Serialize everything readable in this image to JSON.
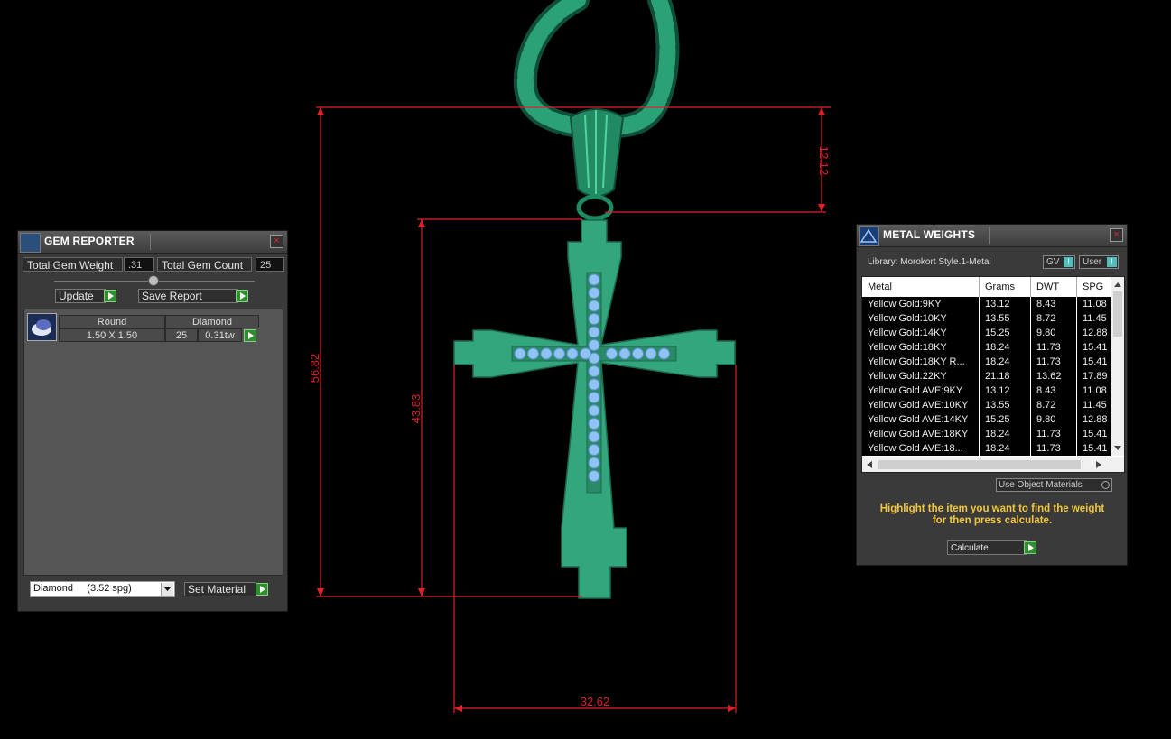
{
  "dimensions": {
    "total_height": "56.82",
    "bail_height": "12.12",
    "cross_height": "43.83",
    "width": "32.62"
  },
  "gem_reporter": {
    "title": "GEM REPORTER",
    "total_weight_label": "Total Gem Weight",
    "total_weight_value": ".31",
    "total_count_label": "Total Gem Count",
    "total_count_value": "25",
    "update_label": "Update",
    "save_report_label": "Save Report",
    "gem": {
      "shape": "Round",
      "material": "Diamond",
      "size": "1.50 X 1.50",
      "count": "25",
      "weight": "0.31tw"
    },
    "material_select": "Diamond     (3.52 spg)",
    "set_material_label": "Set Material",
    "close_glyph": "×"
  },
  "metal_weights": {
    "title": "METAL WEIGHTS",
    "library": "Library: Morokort Style.1-Metal",
    "gv_label": "GV",
    "user_label": "User",
    "columns": [
      "Metal",
      "Grams",
      "DWT",
      "SPG"
    ],
    "rows": [
      [
        "Yellow Gold:9KY",
        "13.12",
        "8.43",
        "11.08"
      ],
      [
        "Yellow Gold:10KY",
        "13.55",
        "8.72",
        "11.45"
      ],
      [
        "Yellow Gold:14KY",
        "15.25",
        "9.80",
        "12.88"
      ],
      [
        "Yellow Gold:18KY",
        "18.24",
        "11.73",
        "15.41"
      ],
      [
        "Yellow Gold:18KY R...",
        "18.24",
        "11.73",
        "15.41"
      ],
      [
        "Yellow Gold:22KY",
        "21.18",
        "13.62",
        "17.89"
      ],
      [
        "Yellow Gold AVE:9KY",
        "13.12",
        "8.43",
        "11.08"
      ],
      [
        "Yellow Gold AVE:10KY",
        "13.55",
        "8.72",
        "11.45"
      ],
      [
        "Yellow Gold AVE:14KY",
        "15.25",
        "9.80",
        "12.88"
      ],
      [
        "Yellow Gold AVE:18KY",
        "18.24",
        "11.73",
        "15.41"
      ],
      [
        "Yellow Gold AVE:18...",
        "18.24",
        "11.73",
        "15.41"
      ]
    ],
    "use_object_materials": "Use Object Materials",
    "hint_line1": "Highlight the item you want to find the weight",
    "hint_line2": "for then press calculate.",
    "calculate_label": "Calculate",
    "close_glyph": "×"
  },
  "colors": {
    "metal": "#33a67e",
    "metal_dark": "#1a6b4e",
    "gem": "#8fc3f2",
    "dimension": "#e0202a",
    "hint": "#f0c83a"
  }
}
